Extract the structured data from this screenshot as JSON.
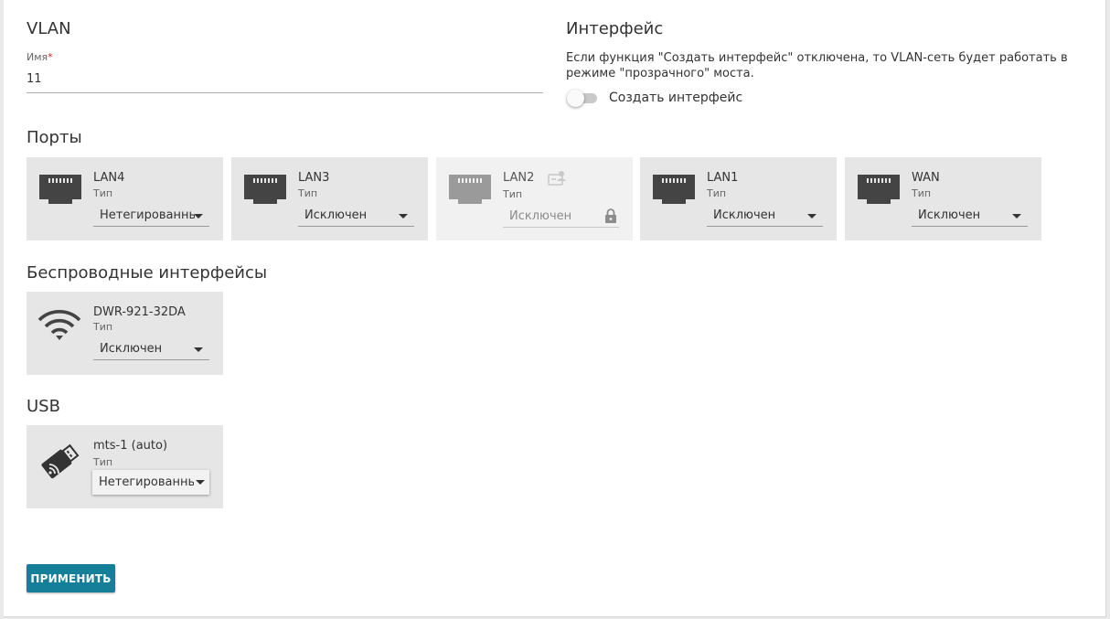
{
  "vlan": {
    "title": "VLAN",
    "name_label": "Имя",
    "required_mark": "*",
    "name_value": "11"
  },
  "interface": {
    "title": "Интерфейс",
    "description": "Если функция \"Создать интерфейс\" отключена, то VLAN-сеть будет работать в режиме \"прозрачного\" моста.",
    "toggle_label": "Создать интерфейс",
    "toggle_on": false
  },
  "ports": {
    "title": "Порты",
    "items": [
      {
        "name": "LAN4",
        "type_label": "Тип",
        "value": "Нетегированный",
        "locked": false
      },
      {
        "name": "LAN3",
        "type_label": "Тип",
        "value": "Исключен",
        "locked": false
      },
      {
        "name": "LAN2",
        "type_label": "Тип",
        "value": "Исключен",
        "locked": true
      },
      {
        "name": "LAN1",
        "type_label": "Тип",
        "value": "Исключен",
        "locked": false
      },
      {
        "name": "WAN",
        "type_label": "Тип",
        "value": "Исключен",
        "locked": false
      }
    ]
  },
  "wireless": {
    "title": "Беспроводные интерфейсы",
    "items": [
      {
        "name": "DWR-921-32DA",
        "type_label": "Тип",
        "value": "Исключен"
      }
    ]
  },
  "usb": {
    "title": "USB",
    "items": [
      {
        "name": "mts-1 (auto)",
        "type_label": "Тип",
        "value": "Нетегированный"
      }
    ]
  },
  "actions": {
    "apply_label": "ПРИМЕНИТЬ"
  },
  "colors": {
    "accent": "#157f9a",
    "card_bg": "#e6e6e6",
    "icon_dark": "#444444",
    "icon_disabled": "#9a9a9a",
    "required": "#d1232a"
  }
}
